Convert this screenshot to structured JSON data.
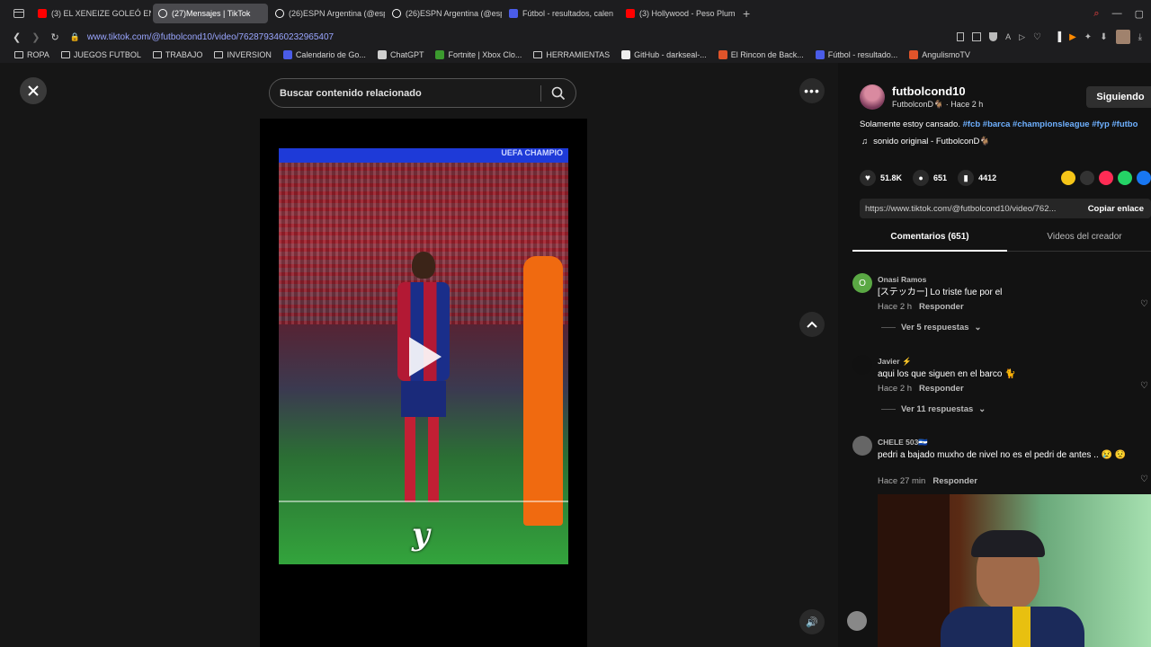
{
  "browser": {
    "tabs": [
      {
        "label": "(3) EL XENEIZE GOLEÓ EN",
        "icon": "youtube-icon",
        "color": "#ff0000"
      },
      {
        "label": "(27)Mensajes | TikTok",
        "icon": "tiktok-icon",
        "color": "#ffffff",
        "active": true
      },
      {
        "label": "(26)ESPN Argentina (@esp",
        "icon": "tiktok-icon",
        "color": "#ffffff"
      },
      {
        "label": "(26)ESPN Argentina (@esp",
        "icon": "tiktok-icon",
        "color": "#ffffff"
      },
      {
        "label": "Fútbol - resultados, calen",
        "icon": "calendar-icon",
        "color": "#4a5ce8"
      },
      {
        "label": "(3) Hollywood - Peso Plum",
        "icon": "youtube-icon",
        "color": "#ff0000"
      }
    ],
    "url": "www.tiktok.com/@futbolcond10/video/7628793460232965407",
    "bookmarks": [
      {
        "label": "ROPA",
        "icon": "folder-icon"
      },
      {
        "label": "JUEGOS FUTBOL",
        "icon": "folder-icon"
      },
      {
        "label": "TRABAJO",
        "icon": "folder-icon"
      },
      {
        "label": "INVERSION",
        "icon": "folder-icon"
      },
      {
        "label": "Calendario de Go...",
        "icon": "calendar-icon"
      },
      {
        "label": "ChatGPT",
        "icon": "chatgpt-icon"
      },
      {
        "label": "Fortnite | Xbox Clo...",
        "icon": "xbox-icon"
      },
      {
        "label": "HERRAMIENTAS",
        "icon": "folder-icon"
      },
      {
        "label": "GitHub - darkseal-...",
        "icon": "github-icon"
      },
      {
        "label": "El Rincon de Back...",
        "icon": "site-icon"
      },
      {
        "label": "Fútbol - resultado...",
        "icon": "calendar-icon"
      },
      {
        "label": "AngulismoTV",
        "icon": "site-icon"
      }
    ]
  },
  "search": {
    "placeholder": "Buscar contenido relacionado"
  },
  "video": {
    "caption_overlay": "y",
    "banner_text": "UEFA CHAMPIO"
  },
  "post": {
    "username": "futbolcond10",
    "display": "FutbolconD🐐 · Hace 2 h",
    "follow_label": "Siguiendo",
    "description": "Solamente estoy cansado.",
    "hashtags": "#fcb #barca #championsleague #fyp #futbo",
    "sound": "sonido original - FutbolconD🐐",
    "likes": "51.8K",
    "comments": "651",
    "saves": "4412",
    "link": "https://www.tiktok.com/@futbolcond10/video/762...",
    "copy_label": "Copiar enlace",
    "tab_comments": "Comentarios (651)",
    "tab_videos": "Videos del creador",
    "share_colors": [
      "#f5c518",
      "#333333",
      "#fe2c55",
      "#25d366",
      "#1877f2"
    ]
  },
  "comments": [
    {
      "avatar_letter": "O",
      "avatar_color": "#5aa844",
      "name": "Onasi Ramos",
      "text": "[ステッカー] Lo triste fue por el",
      "time": "Hace 2 h",
      "reply": "Responder",
      "replies": "Ver 5 respuestas"
    },
    {
      "avatar_letter": "",
      "avatar_color": "#111111",
      "name": "Javier ⚡",
      "text": "aqui los que siguen en el barco 🐈",
      "time": "Hace 2 h",
      "reply": "Responder",
      "replies": "Ver 11 respuestas"
    },
    {
      "avatar_letter": "",
      "avatar_color": "#666666",
      "name": "CHELE 503🇸🇻",
      "text": "pedri a bajado muxho de nivel no es el pedri de antes .. 😢 😟",
      "time": "Hace 27 min",
      "reply": "Responder",
      "replies": ""
    }
  ]
}
